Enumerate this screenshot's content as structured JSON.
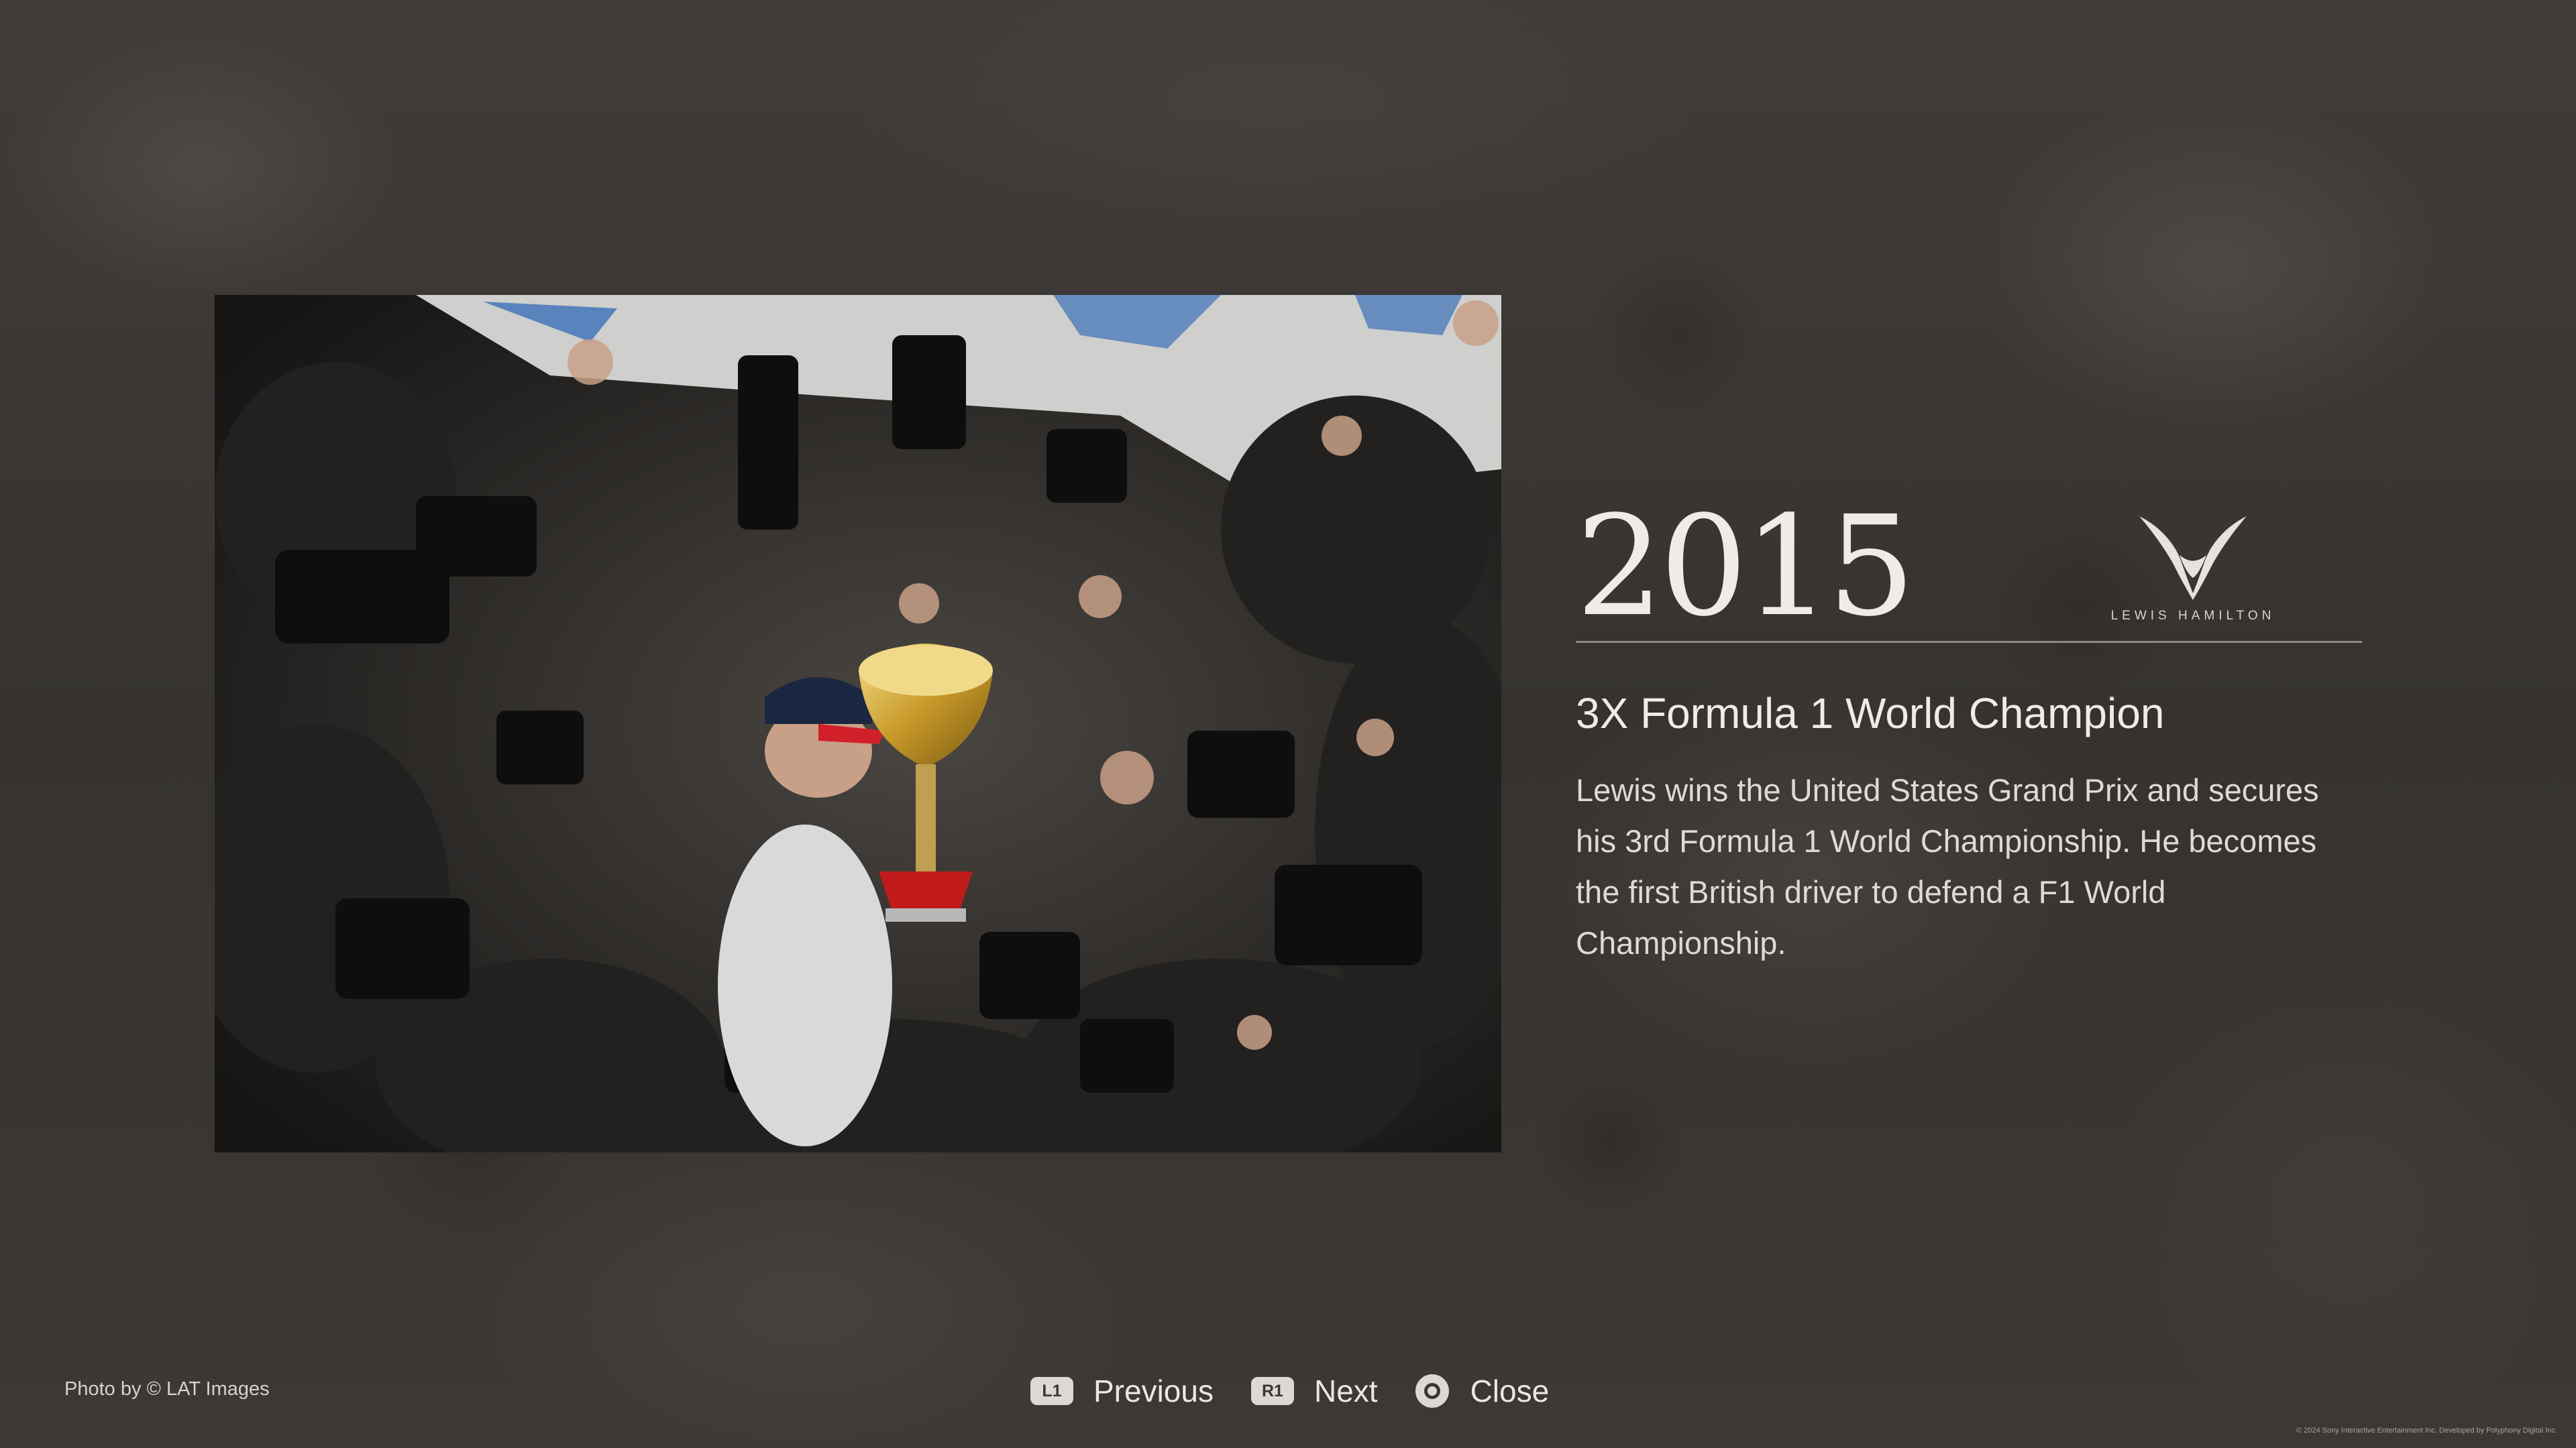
{
  "photo": {
    "alt": "Lewis Hamilton lifting the trophy surrounded by photographers"
  },
  "info": {
    "year": "2015",
    "logo_text": "LEWIS HAMILTON",
    "headline": "3X Formula 1 World Champion",
    "description": "Lewis wins the United States Grand Prix and secures his 3rd Formula 1 World Championship. He becomes the first British driver to defend a F1 World Championship."
  },
  "footer": {
    "credit": "Photo by © LAT Images",
    "controls": [
      {
        "glyph": "L1",
        "label": "Previous"
      },
      {
        "glyph": "R1",
        "label": "Next"
      },
      {
        "glyph": "circle",
        "label": "Close"
      }
    ],
    "copyright": "© 2024 Sony Interactive Entertainment Inc. Developed by Polyphony Digital Inc."
  },
  "colors": {
    "background": "#3a3735",
    "text": "#efece8",
    "divider": "#8e8a86",
    "button": "#dcd9d5"
  }
}
